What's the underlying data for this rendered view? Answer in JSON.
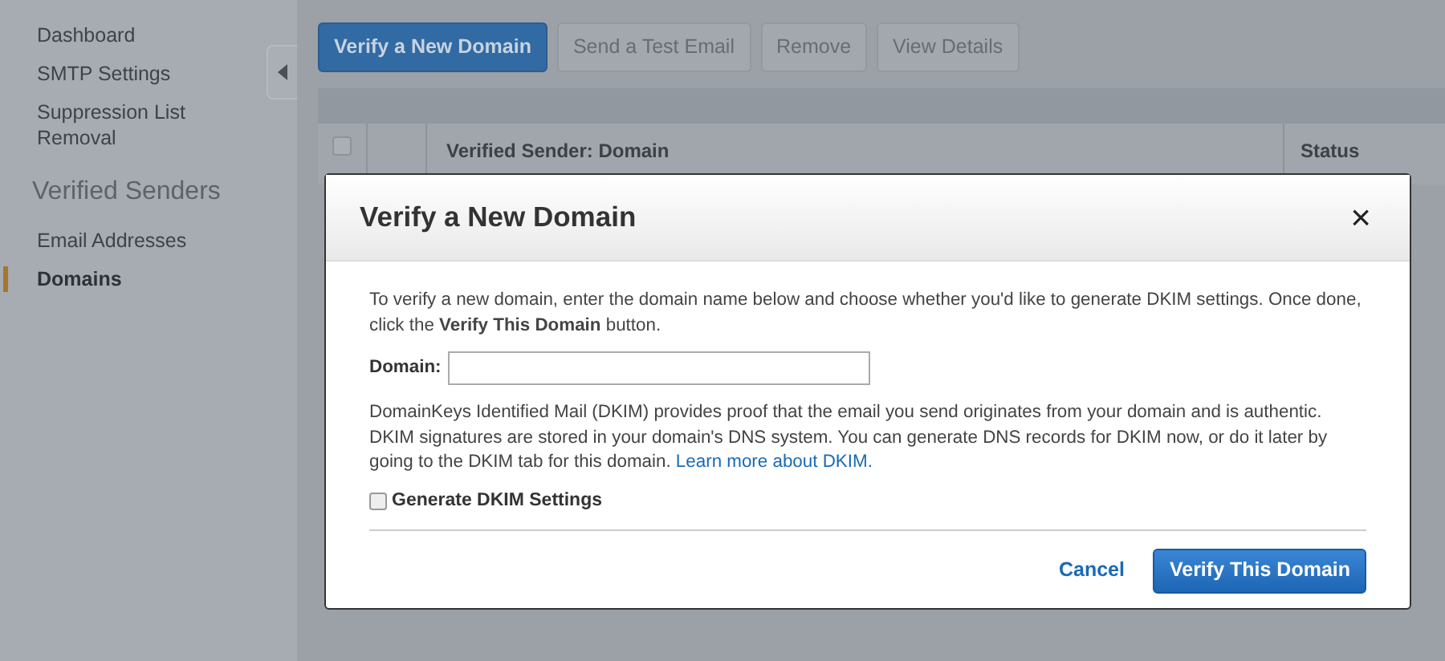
{
  "sidebar": {
    "items": [
      {
        "label": "Dashboard",
        "kind": "link",
        "selected": false
      },
      {
        "label": "SMTP Settings",
        "kind": "link",
        "selected": false
      },
      {
        "label": "Suppression List Removal",
        "kind": "link",
        "selected": false
      },
      {
        "label": "Verified Senders",
        "kind": "heading"
      },
      {
        "label": "Email Addresses",
        "kind": "link",
        "selected": false
      },
      {
        "label": "Domains",
        "kind": "link",
        "selected": true
      }
    ]
  },
  "toolbar": {
    "buttons": [
      {
        "label": "Verify a New Domain",
        "disabled": false
      },
      {
        "label": "Send a Test Email",
        "disabled": true
      },
      {
        "label": "Remove",
        "disabled": true
      },
      {
        "label": "View Details",
        "disabled": true
      }
    ]
  },
  "table": {
    "select_all": {
      "checked": false
    },
    "columns": [
      "Verified Sender: Domain",
      "Status"
    ]
  },
  "dialog": {
    "title": "Verify a New Domain",
    "close": "×",
    "intro": "To verify a new domain, enter the domain name below and choose whether you'd like to generate DKIM settings. Once done, click the **Verify This Domain** button.",
    "domain_label": "Domain:",
    "dkim_text": "DomainKeys Identified Mail (DKIM) provides proof that the email you send originates from your domain and is authentic. DKIM signatures are stored in your domain's DNS system. You can generate DNS records for DKIM now, or do it later by going to the DKIM tab for this domain.",
    "dkim_link": "Learn more about DKIM.",
    "checkbox": {
      "label": "Generate DKIM Settings",
      "checked": false
    },
    "cancel": "Cancel",
    "submit": "Verify This Domain"
  }
}
